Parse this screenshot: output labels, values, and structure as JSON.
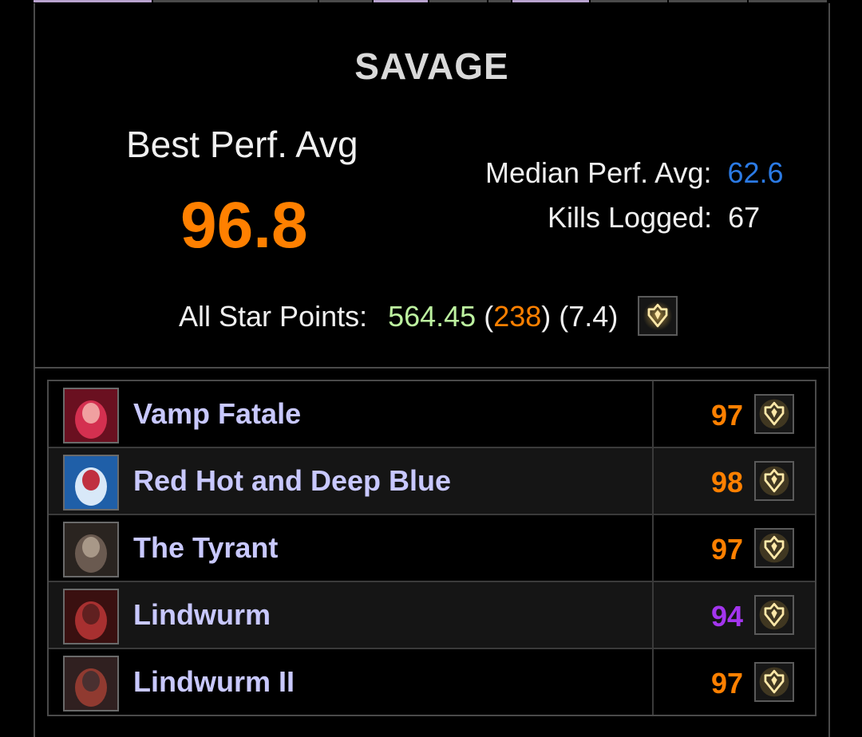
{
  "section": {
    "title": "SAVAGE"
  },
  "summary": {
    "best_label": "Best Perf. Avg",
    "best_value": "96.8",
    "median_label": "Median Perf. Avg:",
    "median_value": "62.6",
    "kills_label": "Kills Logged:",
    "kills_value": "67",
    "allstar_label": "All Star Points:",
    "allstar_points": "564.45",
    "allstar_rank": "238",
    "allstar_extra": "(7.4)"
  },
  "colors": {
    "legendary": "#ff8000",
    "epic": "#a335ee",
    "median_blue": "#2b7ae4",
    "allstar_green": "#bdf2a0",
    "boss_name": "#c8c8ff"
  },
  "bosses": [
    {
      "name": "Vamp Fatale",
      "score": "97",
      "tier": "legendary",
      "avatar_icon": "vamp-fatale-portrait-icon"
    },
    {
      "name": "Red Hot and Deep Blue",
      "score": "98",
      "tier": "legendary",
      "avatar_icon": "red-hot-deep-blue-portrait-icon"
    },
    {
      "name": "The Tyrant",
      "score": "97",
      "tier": "legendary",
      "avatar_icon": "tyrant-portrait-icon"
    },
    {
      "name": "Lindwurm",
      "score": "94",
      "tier": "epic",
      "avatar_icon": "lindwurm-portrait-icon"
    },
    {
      "name": "Lindwurm II",
      "score": "97",
      "tier": "legendary",
      "avatar_icon": "lindwurm-ii-portrait-icon"
    }
  ]
}
